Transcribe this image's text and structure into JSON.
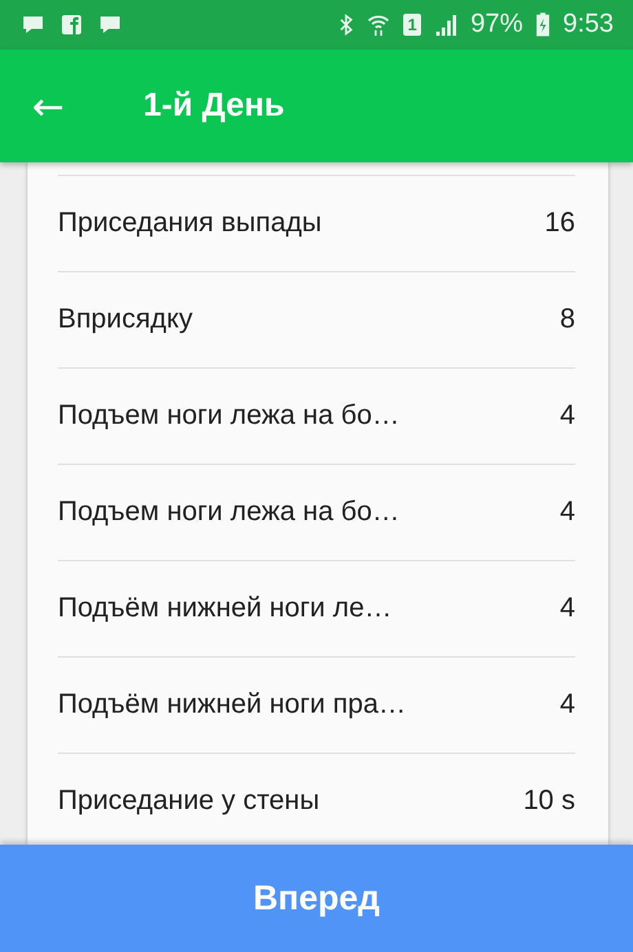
{
  "status_bar": {
    "sim_label": "1",
    "battery": "97%",
    "time": "9:53",
    "charging": true
  },
  "app_bar": {
    "back": "←",
    "title": "1-й День"
  },
  "exercises": [
    {
      "name": "Приседания выпады",
      "count": "16"
    },
    {
      "name": "Вприсядку",
      "count": "8"
    },
    {
      "name": "Подъем ноги лежа на бо…",
      "count": "4"
    },
    {
      "name": "Подъем ноги лежа на бо…",
      "count": "4"
    },
    {
      "name": "Подъём нижней ноги ле…",
      "count": "4"
    },
    {
      "name": "Подъём нижней ноги пра…",
      "count": "4"
    },
    {
      "name": "Приседание у стены",
      "count": "10 s"
    }
  ],
  "next_button": "Вперед"
}
